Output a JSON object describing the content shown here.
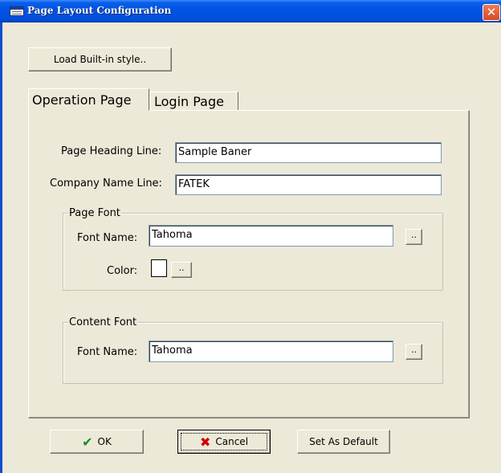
{
  "window": {
    "title": "Page Layout Configuration",
    "close_symbol": "✕"
  },
  "toolbar": {
    "load_builtin_label": "Load Built-in style.."
  },
  "tabs": [
    {
      "label": "Operation Page",
      "active": true
    },
    {
      "label": "Login Page",
      "active": false
    }
  ],
  "form": {
    "page_heading_label": "Page Heading Line:",
    "page_heading_value": "Sample Baner",
    "company_name_label": "Company Name Line:",
    "company_name_value": "FATEK"
  },
  "page_font": {
    "legend": "Page Font",
    "font_name_label": "Font Name:",
    "font_name_value": "Tahoma",
    "browse_label": "..",
    "color_label": "Color:",
    "color_value": "#ffffff",
    "color_browse_label": ".."
  },
  "content_font": {
    "legend": "Content Font",
    "font_name_label": "Font Name:",
    "font_name_value": "Tahoma",
    "browse_label": ".."
  },
  "footer": {
    "ok_label": "OK",
    "cancel_label": "Cancel",
    "default_label": "Set As Default"
  },
  "icons": {
    "ok": "check-icon",
    "cancel": "x-icon",
    "app": "window-icon"
  }
}
